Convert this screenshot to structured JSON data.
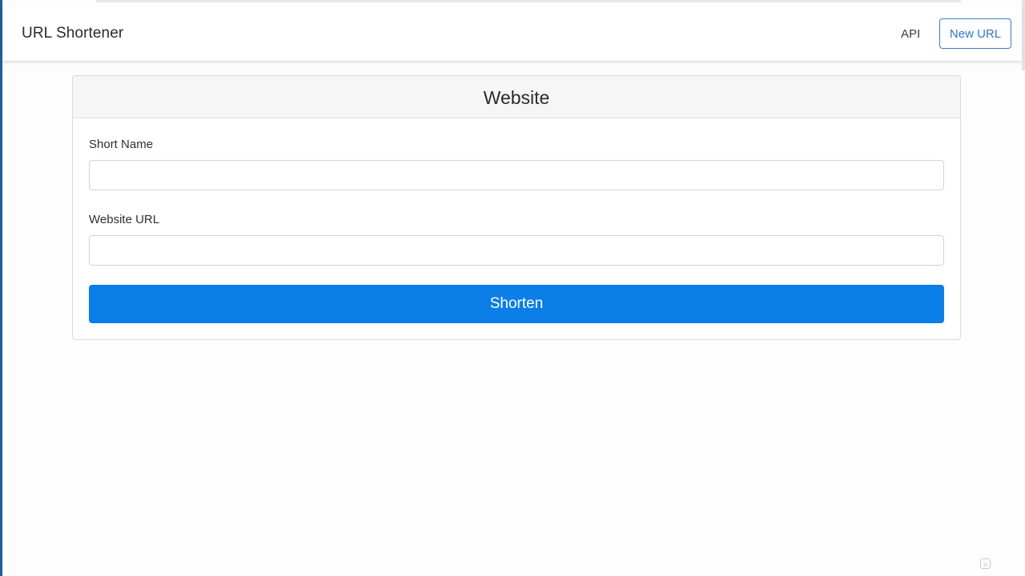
{
  "navbar": {
    "brand": "URL Shortener",
    "api_link": "API",
    "new_url_button": "New URL"
  },
  "card": {
    "title": "Website",
    "fields": [
      {
        "label": "Short Name",
        "value": "",
        "placeholder": ""
      },
      {
        "label": "Website URL",
        "value": "",
        "placeholder": ""
      }
    ],
    "submit_label": "Shorten"
  },
  "watermark": {
    "icon": "udemy-logo-icon"
  },
  "colors": {
    "primary": "#0b7ee8",
    "outline_button": "#2f78c4",
    "page_background": "#fdfdfd",
    "left_edge": "#1f5f9a"
  }
}
